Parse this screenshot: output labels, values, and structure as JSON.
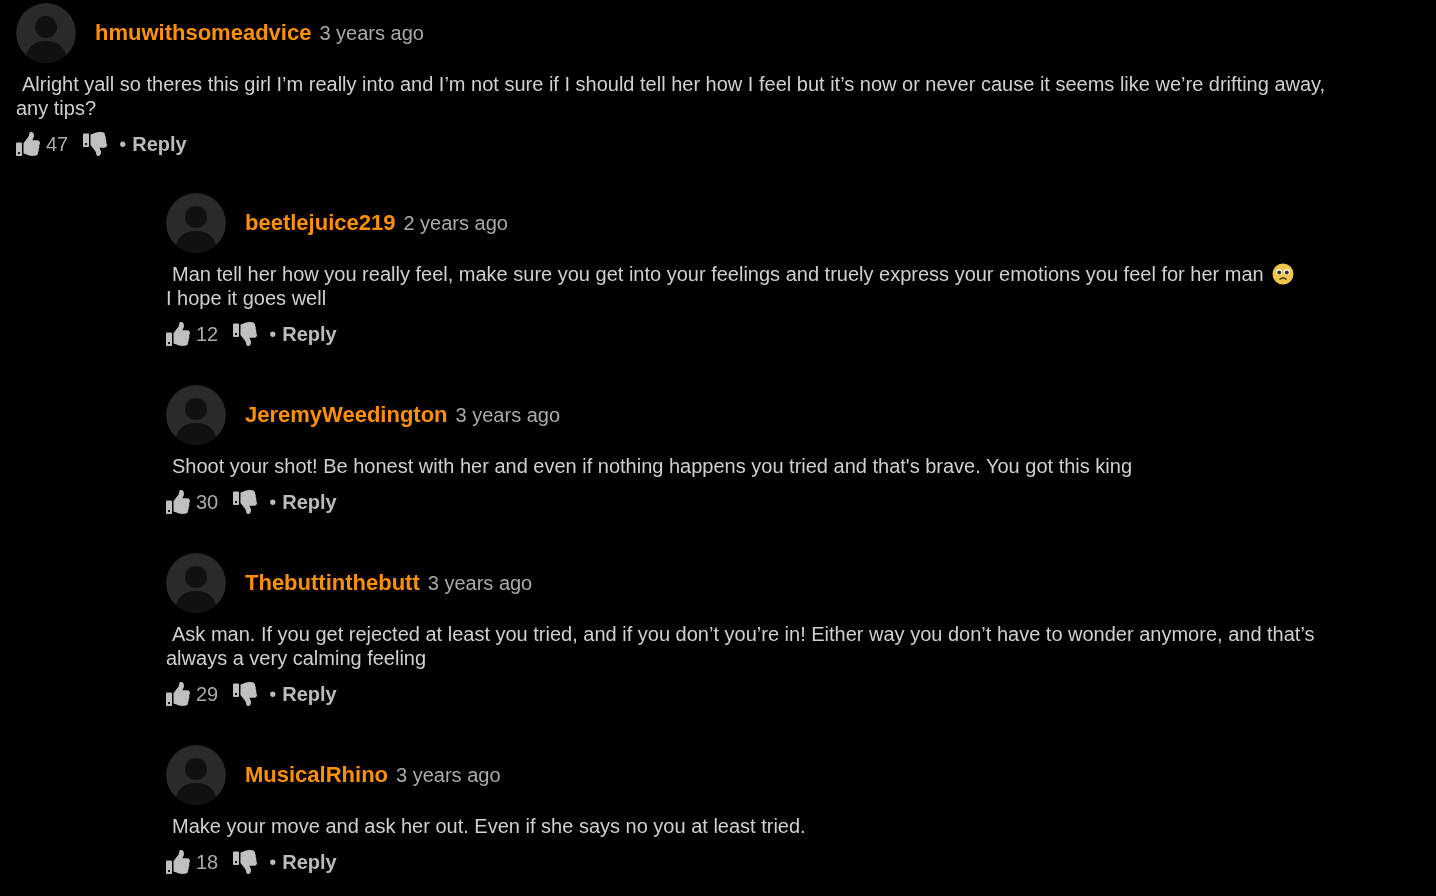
{
  "comments": [
    {
      "username": "hmuwithsomeadvice",
      "time": "3 years ago",
      "text": "Alright yall so theres this girl I’m really into and I’m not sure if I should tell her how I feel but it’s now or never cause it seems like we’re drifting away, any tips?",
      "emoji": false,
      "likes": "47",
      "separator": "•",
      "reply_label": "Reply",
      "children": [
        {
          "username": "beetlejuice219",
          "time": "2 years ago",
          "text": "Man tell her how you really feel, make sure you get into your feelings and truely express your emotions you feel for her man",
          "emoji": true,
          "text_after": "I hope it goes well",
          "likes": "12",
          "separator": "•",
          "reply_label": "Reply"
        },
        {
          "username": "JeremyWeedington",
          "time": "3 years ago",
          "text": "Shoot your shot! Be honest with her and even if nothing happens you tried and that's brave. You got this king",
          "emoji": false,
          "likes": "30",
          "separator": "•",
          "reply_label": "Reply"
        },
        {
          "username": "Thebuttinthebutt",
          "time": "3 years ago",
          "text": "Ask man. If you get rejected at least you tried, and if you don’t you’re in! Either way you don’t have to wonder anymore, and that’s always a very calming feeling",
          "emoji": false,
          "likes": "29",
          "separator": "•",
          "reply_label": "Reply"
        },
        {
          "username": "MusicalRhino",
          "time": "3 years ago",
          "text": "Make your move and ask her out. Even if she says no you at least tried.",
          "emoji": false,
          "likes": "18",
          "separator": "•",
          "reply_label": "Reply"
        }
      ]
    }
  ]
}
